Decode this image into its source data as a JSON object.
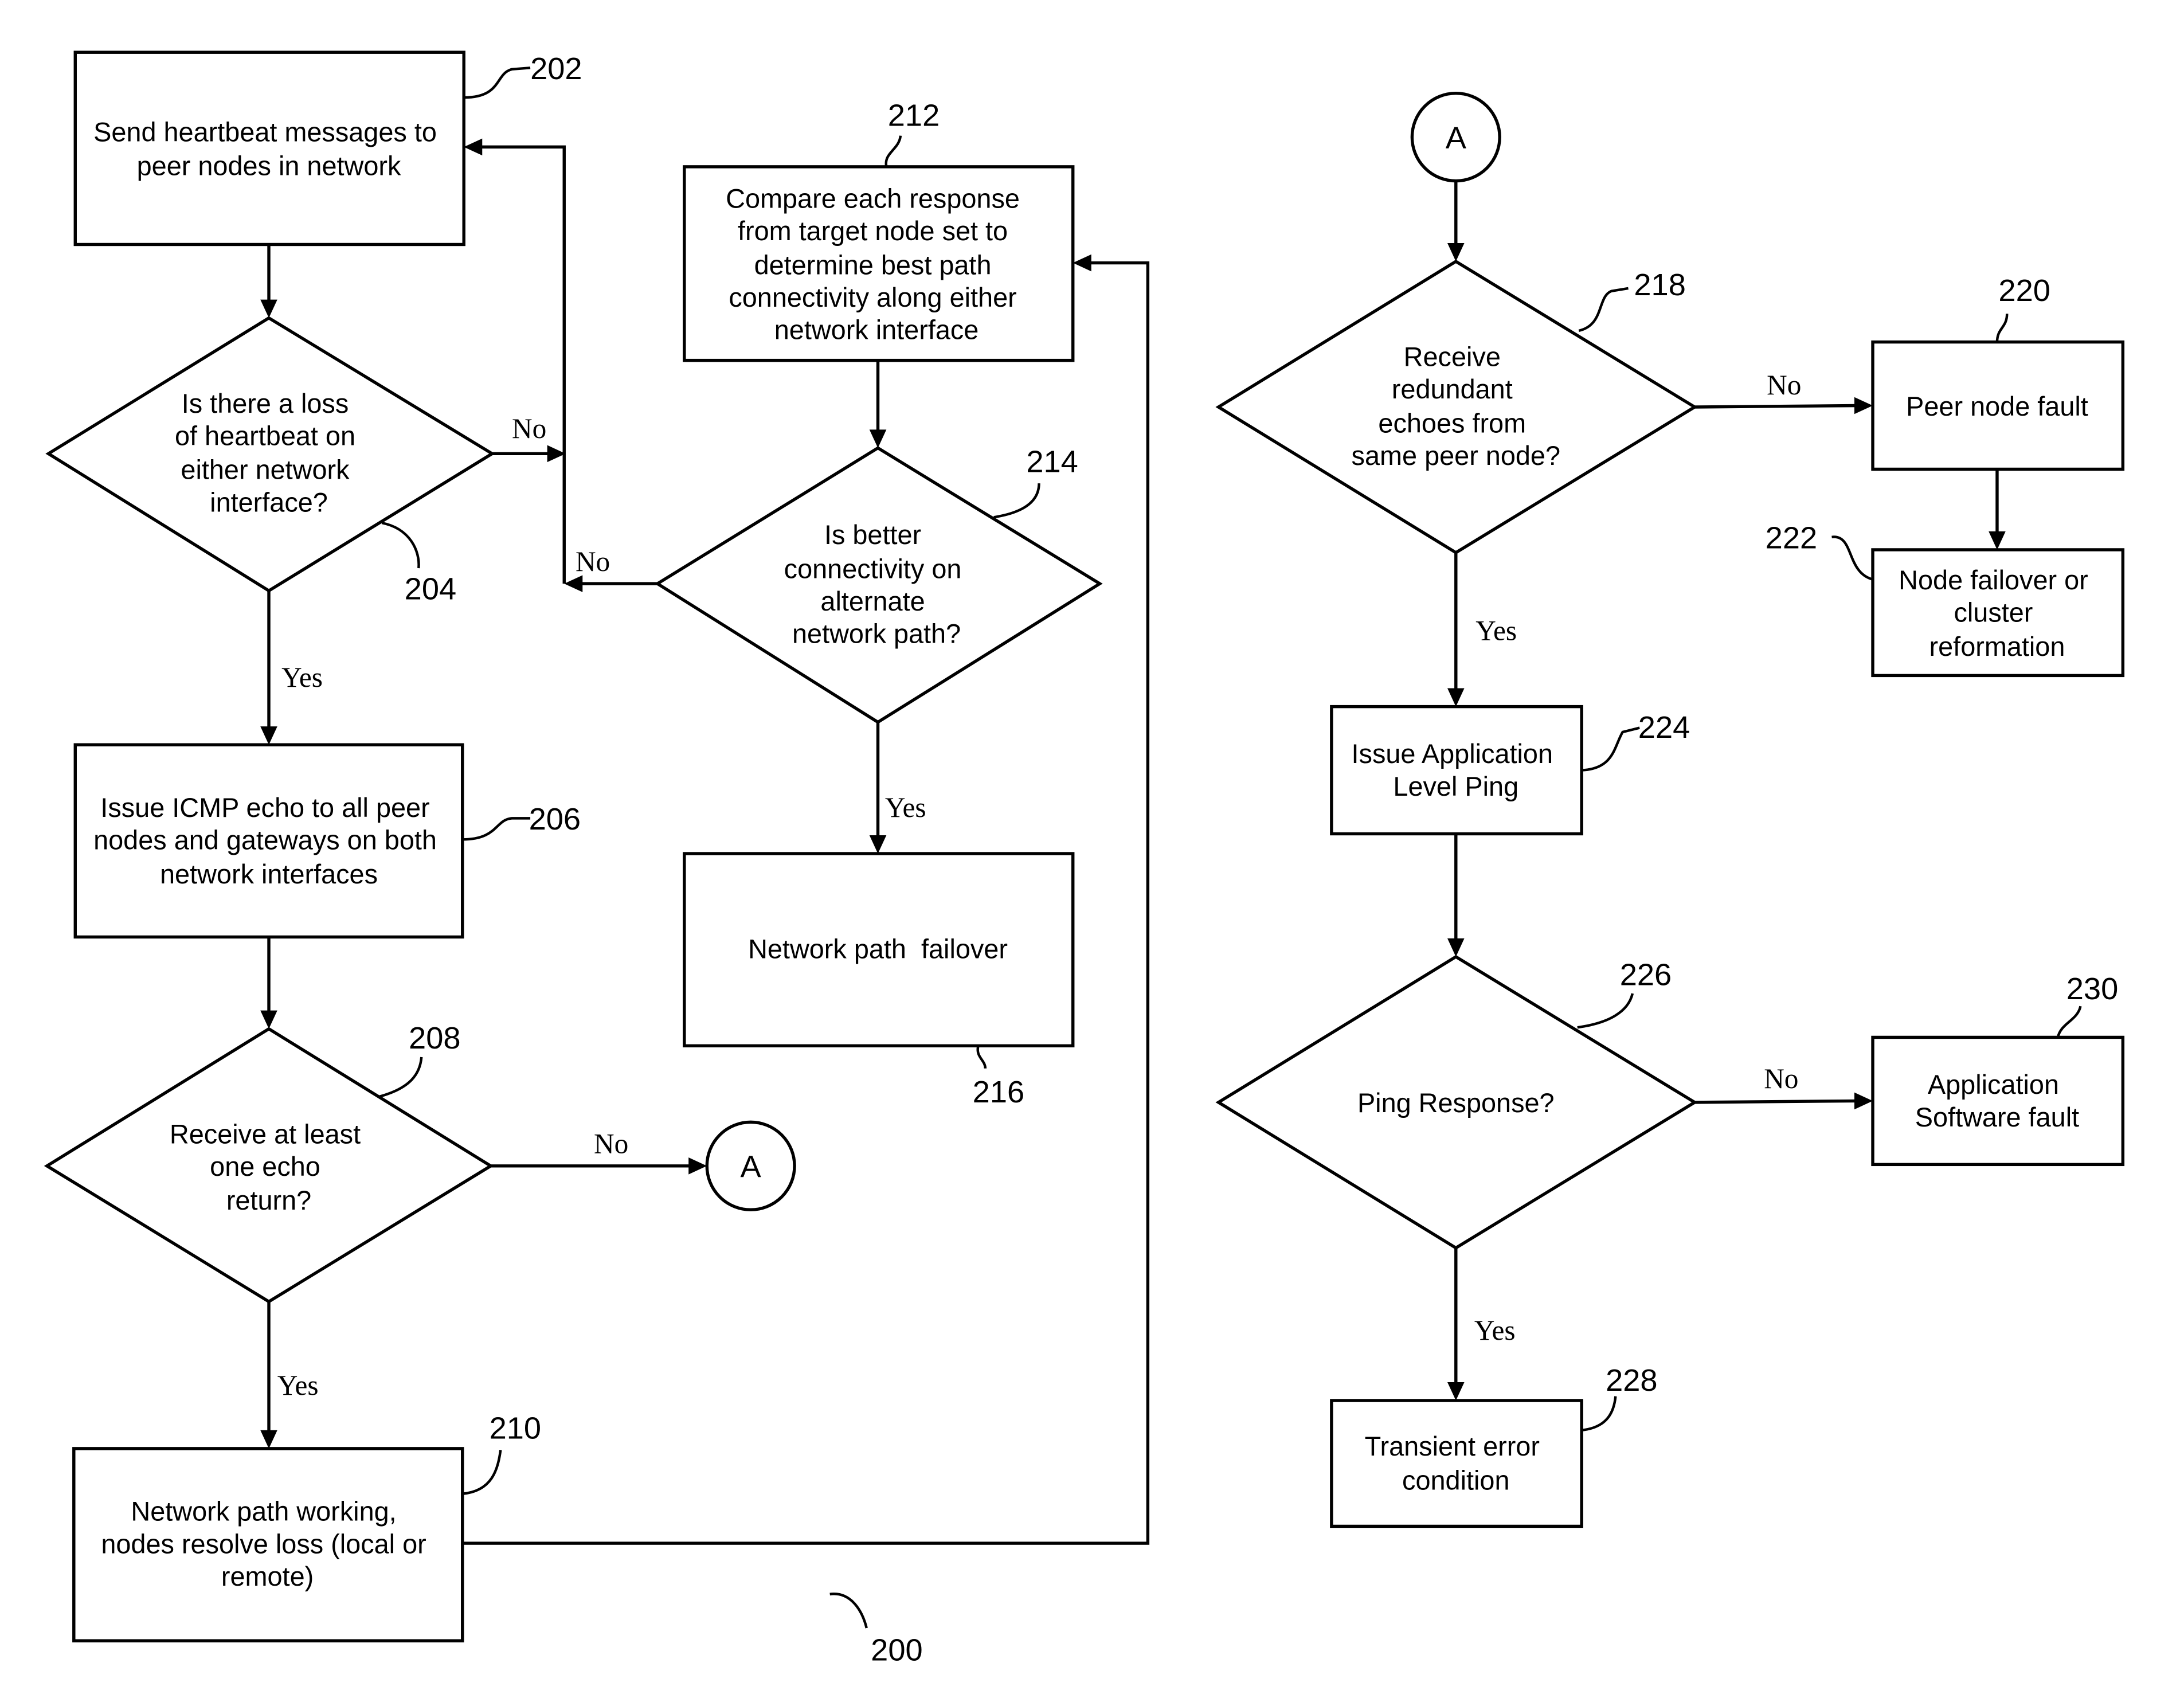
{
  "figure_number": "200",
  "nodes": {
    "n202": {
      "ref": "202",
      "lines": [
        "Send heartbeat messages to",
        "peer nodes in network"
      ]
    },
    "n204": {
      "ref": "204",
      "lines": [
        "Is there a loss",
        "of heartbeat on",
        "either network",
        "interface?"
      ]
    },
    "n206": {
      "ref": "206",
      "lines": [
        "Issue ICMP echo to all peer",
        "nodes and gateways on both",
        "network interfaces"
      ]
    },
    "n208": {
      "ref": "208",
      "lines": [
        "Receive at least",
        "one echo",
        "return?"
      ]
    },
    "n210": {
      "ref": "210",
      "lines": [
        "Network path working,",
        "nodes resolve loss (local or",
        "remote)"
      ]
    },
    "n212": {
      "ref": "212",
      "lines": [
        "Compare each response",
        "from target node set to",
        "determine best path",
        "connectivity along either",
        "network interface"
      ]
    },
    "n214": {
      "ref": "214",
      "lines": [
        "Is better",
        "connectivity on",
        "alternate",
        "network path?"
      ]
    },
    "n216": {
      "ref": "216",
      "lines": [
        "Network path  failover"
      ]
    },
    "n218": {
      "ref": "218",
      "lines": [
        "Receive",
        "redundant",
        "echoes from",
        "same peer node?"
      ]
    },
    "n220": {
      "ref": "220",
      "lines": [
        "Peer node fault"
      ]
    },
    "n222": {
      "ref": "222",
      "lines": [
        "Node failover or",
        "cluster",
        "reformation"
      ]
    },
    "n224": {
      "ref": "224",
      "lines": [
        "Issue Application",
        "Level Ping"
      ]
    },
    "n226": {
      "ref": "226",
      "lines": [
        "Ping Response?"
      ]
    },
    "n228": {
      "ref": "228",
      "lines": [
        "Transient error",
        "condition"
      ]
    },
    "n230": {
      "ref": "230",
      "lines": [
        "Application",
        "Software fault"
      ]
    }
  },
  "connectors": {
    "a_out": "A",
    "a_in": "A"
  },
  "edge_labels": {
    "n204_no": "No",
    "n204_yes": "Yes",
    "n214_no": "No",
    "n214_yes": "Yes",
    "n208_no": "No",
    "n208_yes": "Yes",
    "n218_no": "No",
    "n218_yes": "Yes",
    "n226_no": "No",
    "n226_yes": "Yes"
  }
}
